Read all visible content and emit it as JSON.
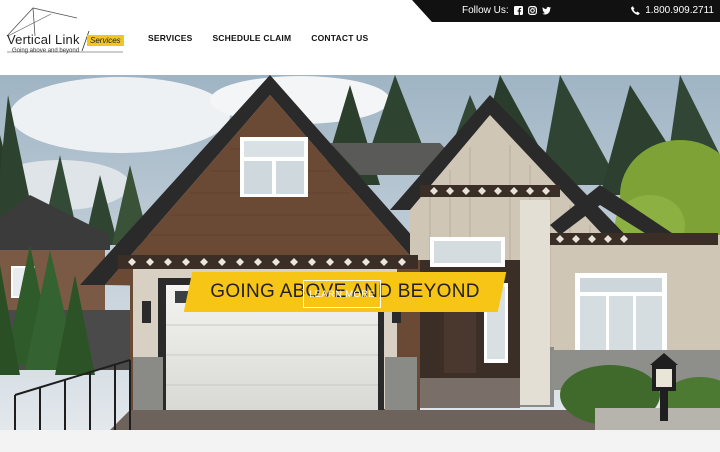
{
  "topbar": {
    "follow_label": "Follow Us:",
    "social_icons": [
      "facebook-icon",
      "instagram-icon",
      "twitter-icon"
    ],
    "phone": "1.800.909.2711"
  },
  "logo": {
    "name": "Vertical Link",
    "tag": "Services",
    "tagline": "Going above and beyond",
    "accent_color": "#f2c61f"
  },
  "nav": {
    "items": [
      {
        "label": "SERVICES"
      },
      {
        "label": "SCHEDULE CLAIM"
      },
      {
        "label": "CONTACT US"
      }
    ]
  },
  "hero": {
    "headline": "GOING ABOVE AND BEYOND",
    "cta_label": "LEARN MORE",
    "banner_color": "#f6c515"
  }
}
